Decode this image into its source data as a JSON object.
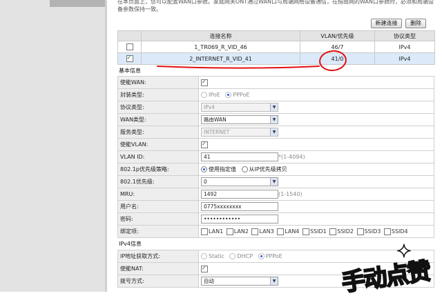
{
  "intro_text": "在本页面上，您可以配置WAN口参数。家庭网关ONT通过WAN口与局端网络设备通信，在指南网的WAN口参数时，必须和局端设备参数保持一致。",
  "buttons": {
    "new_connection": "新建连接",
    "delete": "删除"
  },
  "connection_table": {
    "headers": [
      "",
      "连接名称",
      "VLAN/优先级",
      "协议类型"
    ],
    "rows": [
      {
        "checked": false,
        "name": "1_TR069_R_VID_46",
        "vlan": "46/7",
        "protocol": "IPv4",
        "selected": false
      },
      {
        "checked": true,
        "name": "2_INTERNET_R_VID_41",
        "vlan": "41/0",
        "protocol": "IPv4",
        "selected": true
      }
    ]
  },
  "basic_info": {
    "section_title": "基本信息",
    "enable_wan": {
      "label": "使能WAN:",
      "checked": true
    },
    "encap_type": {
      "label": "封装类型:",
      "options": [
        "IPoE",
        "PPPoE"
      ],
      "selected": "PPPoE"
    },
    "protocol_type": {
      "label": "协议类型:",
      "value": "IPv4"
    },
    "wan_type": {
      "label": "WAN类型:",
      "value": "路由WAN"
    },
    "service_type": {
      "label": "服务类型:",
      "value": "INTERNET"
    },
    "enable_vlan": {
      "label": "使能VLAN:",
      "checked": true
    },
    "vlan_id": {
      "label": "VLAN ID:",
      "value": "41",
      "hint": "*(1-4094)"
    },
    "priority_policy": {
      "label": "802.1p优先级策略:",
      "options": [
        "使用指定值",
        "从IP优先级拷贝"
      ],
      "selected": "使用指定值"
    },
    "priority": {
      "label": "802.1优先级:",
      "value": "0"
    },
    "mru": {
      "label": "MRU:",
      "value": "1492",
      "hint": "(1-1540)"
    },
    "username": {
      "label": "用户名:",
      "value": "0775xxxxxxxx"
    },
    "password": {
      "label": "密码:",
      "value": "••••••••••••"
    },
    "binding": {
      "label": "绑定项:",
      "items": [
        "LAN1",
        "LAN2",
        "LAN3",
        "LAN4",
        "SSID1",
        "SSID2",
        "SSID3",
        "SSID4"
      ]
    }
  },
  "ipv4_info": {
    "section_title": "IPv4信息",
    "ip_mode": {
      "label": "IP地址获取方式:",
      "options": [
        "Static",
        "DHCP",
        "PPPoE"
      ],
      "selected": "PPPoE"
    },
    "enable_nat": {
      "label": "使能NAT:",
      "checked": true
    },
    "dial_mode": {
      "label": "拨号方式:",
      "value": "自动"
    }
  },
  "watermark": {
    "text": "手动点赞"
  },
  "colors": {
    "annotation_red": "#e01010",
    "selected_row": "#dbe9f8",
    "header_bg": "#e4e4e4"
  }
}
